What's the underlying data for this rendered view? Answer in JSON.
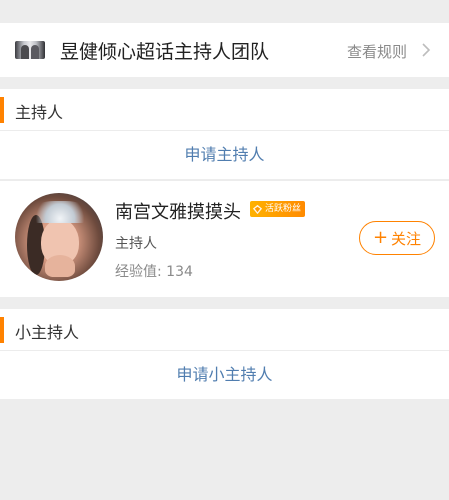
{
  "header": {
    "title": "昱健倾心超话主持人团队",
    "rules_label": "查看规则"
  },
  "hosts_section": {
    "title": "主持人",
    "apply_label": "申请主持人"
  },
  "host": {
    "name": "南宫文雅摸摸头",
    "badge": "活跃粉丝",
    "role": "主持人",
    "exp": "经验值: 134",
    "follow_label": "关注"
  },
  "sub_hosts_section": {
    "title": "小主持人",
    "apply_label": "申请小主持人"
  },
  "colors": {
    "accent": "#ff8200",
    "link": "#507daf",
    "background": "#ededed"
  }
}
